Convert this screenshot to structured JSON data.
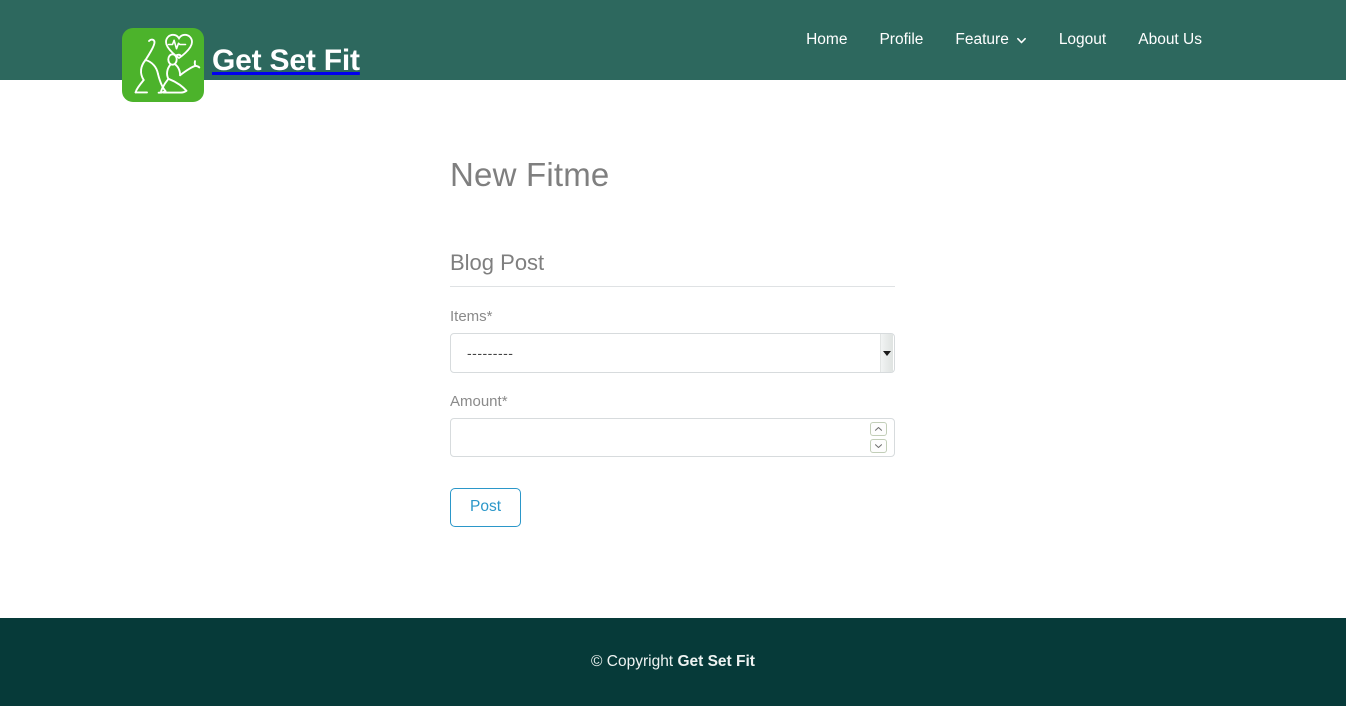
{
  "header": {
    "brand_name": "Get Set Fit",
    "logo_icon": "fitness-yoga-heart-logo",
    "logo_bg_color": "#4cb32b",
    "bar_color": "#2d685e",
    "nav": [
      {
        "label": "Home",
        "name": "nav-link-home",
        "has_caret": false
      },
      {
        "label": "Profile",
        "name": "nav-link-profile",
        "has_caret": false
      },
      {
        "label": "Feature",
        "name": "nav-link-feature",
        "has_caret": true,
        "caret_icon": "chevron-down-icon"
      },
      {
        "label": "Logout",
        "name": "nav-link-logout",
        "has_caret": false
      },
      {
        "label": "About Us",
        "name": "nav-link-about-us",
        "has_caret": false
      }
    ]
  },
  "main": {
    "page_title": "New Fitme",
    "form": {
      "legend": "Blog Post",
      "items_field": {
        "label": "Items*",
        "selected_value": "---------",
        "options": [
          "---------"
        ],
        "arrow_icon": "dropdown-triangle-icon"
      },
      "amount_field": {
        "label": "Amount*",
        "value": "",
        "placeholder": "",
        "increment_icon": "chevron-up-icon",
        "decrement_icon": "chevron-down-icon"
      },
      "submit_label": "Post"
    }
  },
  "footer": {
    "copyright_symbol": "©",
    "copyright_prefix": "Copyright",
    "brand_name": "Get Set Fit",
    "bar_color": "#063a39"
  },
  "colors": {
    "header_teal": "#2d685e",
    "footer_teal": "#063a39",
    "logo_green": "#4cb32b",
    "accent_blue": "#2b97c9",
    "muted_gray": "#7f7f7f",
    "border_gray": "#d7dbdd"
  }
}
